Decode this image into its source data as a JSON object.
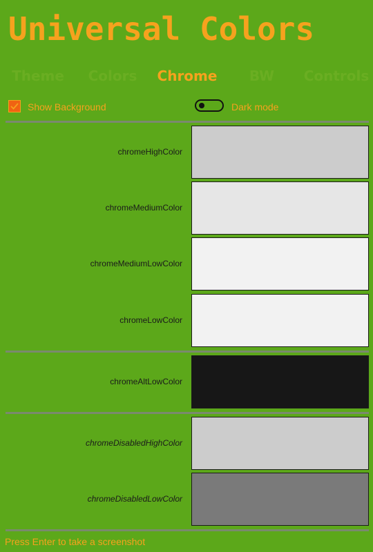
{
  "app": {
    "title": "Universal Colors"
  },
  "tabs": [
    {
      "label": "Theme",
      "active": false
    },
    {
      "label": "Colors",
      "active": false
    },
    {
      "label": "Chrome",
      "active": true
    },
    {
      "label": "BW",
      "active": false
    },
    {
      "label": "Controls",
      "active": false
    }
  ],
  "options": {
    "show_background": {
      "label": "Show Background",
      "checked": true
    },
    "dark_mode": {
      "label": "Dark mode",
      "on": false
    }
  },
  "groups": [
    {
      "items": [
        {
          "name": "chromeHighColor",
          "color": "#cccccc",
          "italic": false
        },
        {
          "name": "chromeMediumColor",
          "color": "#e6e6e6",
          "italic": false
        },
        {
          "name": "chromeMediumLowColor",
          "color": "#f2f2f2",
          "italic": false
        },
        {
          "name": "chromeLowColor",
          "color": "#f2f2f2",
          "italic": false
        }
      ]
    },
    {
      "items": [
        {
          "name": "chromeAltLowColor",
          "color": "#171717",
          "italic": false
        }
      ]
    },
    {
      "items": [
        {
          "name": "chromeDisabledHighColor",
          "color": "#cccccc",
          "italic": true
        },
        {
          "name": "chromeDisabledLowColor",
          "color": "#7a7a7a",
          "italic": true
        }
      ]
    }
  ],
  "status": {
    "text": "Press Enter to take a screenshot"
  },
  "colors": {
    "background": "#5ca81a",
    "accent": "#f6a21e",
    "inactive_tab": "#6aae22",
    "checkbox_fill": "#f06312"
  }
}
